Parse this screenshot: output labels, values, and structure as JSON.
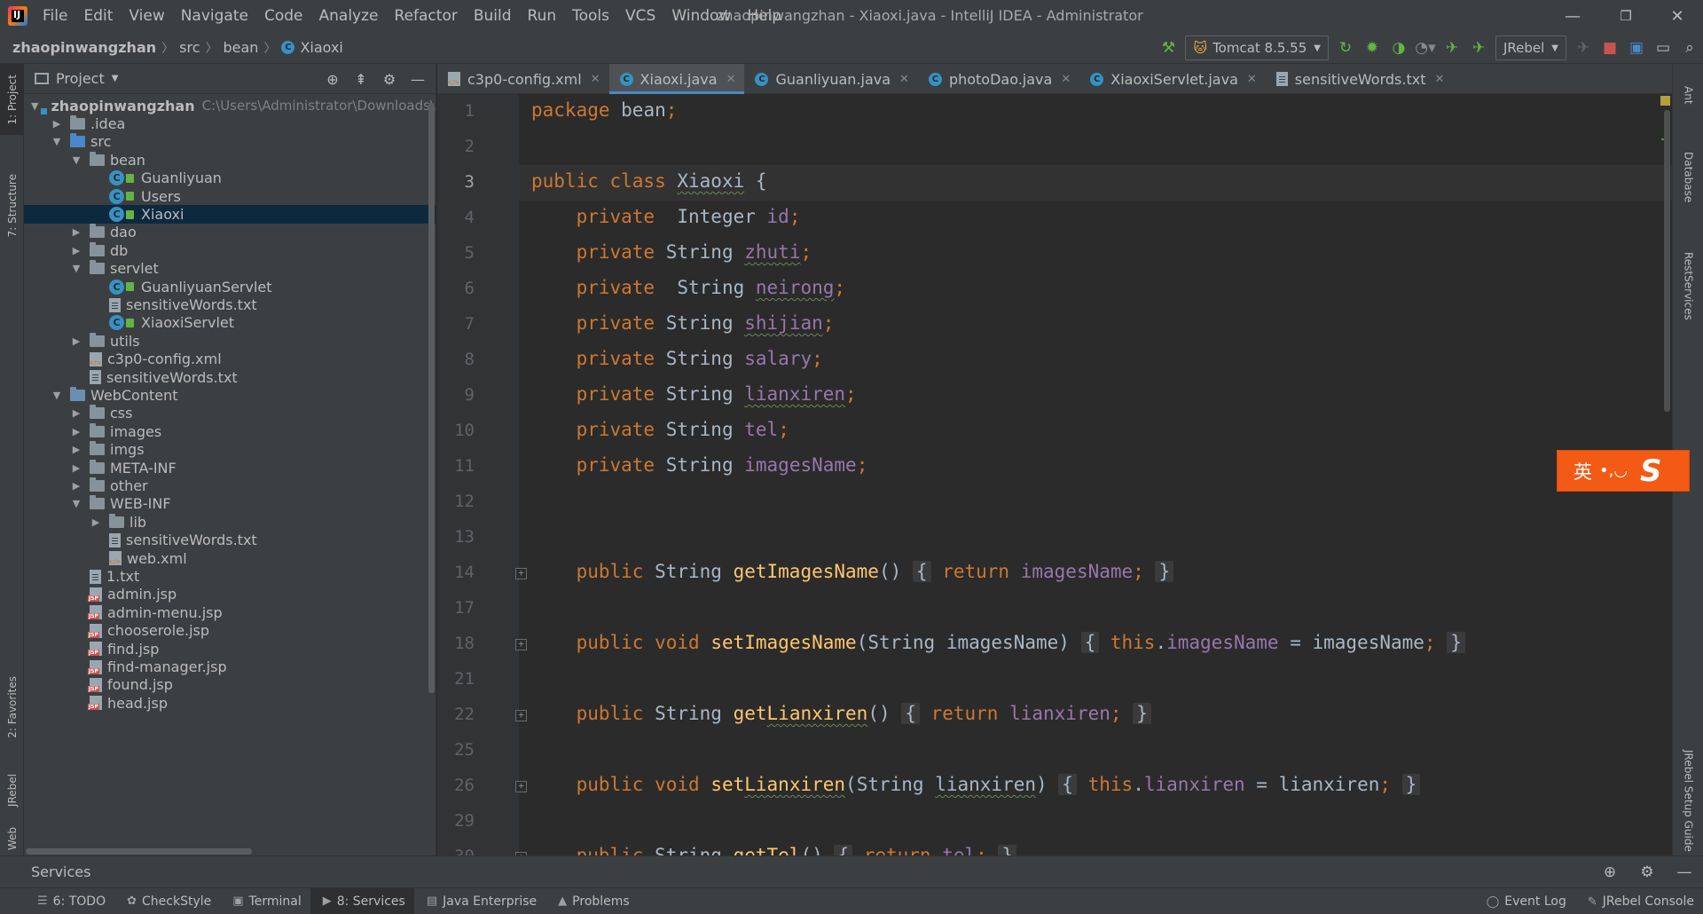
{
  "app": {
    "logo_text": "IJ",
    "window_title": "zhaopinwangzhan - Xiaoxi.java - IntelliJ IDEA - Administrator"
  },
  "menu": [
    "File",
    "Edit",
    "View",
    "Navigate",
    "Code",
    "Analyze",
    "Refactor",
    "Build",
    "Run",
    "Tools",
    "VCS",
    "Window",
    "Help"
  ],
  "window_controls": {
    "minimize": "—",
    "restore": "❐",
    "close": "✕"
  },
  "breadcrumb": {
    "project": "zhaopinwangzhan",
    "src": "src",
    "pkg": "bean",
    "cls": "Xiaoxi"
  },
  "toolbar": {
    "run_config": "Tomcat 8.5.55",
    "jrebel": "JRebel"
  },
  "left_tools": {
    "project": "1: Project",
    "structure": "7: Structure",
    "favorites": "2: Favorites",
    "jrebel": "JRebel",
    "web": "Web"
  },
  "right_tools": {
    "ant": "Ant",
    "database": "Database",
    "rest": "RestServices",
    "jrebel_guide": "JRebel Setup Guide"
  },
  "project_panel": {
    "title": "Project",
    "tree": [
      {
        "label": "zhaopinwangzhan",
        "depth": 0,
        "icon": "module",
        "open": true,
        "bold": true,
        "hint": "C:\\Users\\Administrator\\Downloads\\z"
      },
      {
        "label": ".idea",
        "depth": 1,
        "icon": "folder",
        "open": false
      },
      {
        "label": "src",
        "depth": 1,
        "icon": "folder-src",
        "open": true
      },
      {
        "label": "bean",
        "depth": 2,
        "icon": "folder",
        "open": true
      },
      {
        "label": "Guanliyuan",
        "depth": 3,
        "icon": "class"
      },
      {
        "label": "Users",
        "depth": 3,
        "icon": "class"
      },
      {
        "label": "Xiaoxi",
        "depth": 3,
        "icon": "class",
        "selected": true
      },
      {
        "label": "dao",
        "depth": 2,
        "icon": "folder",
        "open": false
      },
      {
        "label": "db",
        "depth": 2,
        "icon": "folder",
        "open": false
      },
      {
        "label": "servlet",
        "depth": 2,
        "icon": "folder",
        "open": true
      },
      {
        "label": "GuanliyuanServlet",
        "depth": 3,
        "icon": "class"
      },
      {
        "label": "sensitiveWords.txt",
        "depth": 3,
        "icon": "file"
      },
      {
        "label": "XiaoxiServlet",
        "depth": 3,
        "icon": "class"
      },
      {
        "label": "utils",
        "depth": 2,
        "icon": "folder",
        "open": false
      },
      {
        "label": "c3p0-config.xml",
        "depth": 2,
        "icon": "xml"
      },
      {
        "label": "sensitiveWords.txt",
        "depth": 2,
        "icon": "file"
      },
      {
        "label": "WebContent",
        "depth": 1,
        "icon": "folder-web",
        "open": true
      },
      {
        "label": "css",
        "depth": 2,
        "icon": "folder",
        "open": false
      },
      {
        "label": "images",
        "depth": 2,
        "icon": "folder",
        "open": false
      },
      {
        "label": "imgs",
        "depth": 2,
        "icon": "folder",
        "open": false
      },
      {
        "label": "META-INF",
        "depth": 2,
        "icon": "folder",
        "open": false
      },
      {
        "label": "other",
        "depth": 2,
        "icon": "folder",
        "open": false
      },
      {
        "label": "WEB-INF",
        "depth": 2,
        "icon": "folder",
        "open": true
      },
      {
        "label": "lib",
        "depth": 3,
        "icon": "folder",
        "open": false
      },
      {
        "label": "sensitiveWords.txt",
        "depth": 3,
        "icon": "file"
      },
      {
        "label": "web.xml",
        "depth": 3,
        "icon": "xml"
      },
      {
        "label": "1.txt",
        "depth": 2,
        "icon": "file"
      },
      {
        "label": "admin.jsp",
        "depth": 2,
        "icon": "jsp"
      },
      {
        "label": "admin-menu.jsp",
        "depth": 2,
        "icon": "jsp"
      },
      {
        "label": "chooserole.jsp",
        "depth": 2,
        "icon": "jsp"
      },
      {
        "label": "find.jsp",
        "depth": 2,
        "icon": "jsp"
      },
      {
        "label": "find-manager.jsp",
        "depth": 2,
        "icon": "jsp"
      },
      {
        "label": "found.jsp",
        "depth": 2,
        "icon": "jsp"
      },
      {
        "label": "head.jsp",
        "depth": 2,
        "icon": "jsp"
      }
    ]
  },
  "editor_tabs": [
    {
      "label": "c3p0-config.xml",
      "icon": "xml"
    },
    {
      "label": "Xiaoxi.java",
      "icon": "class",
      "active": true
    },
    {
      "label": "Guanliyuan.java",
      "icon": "class"
    },
    {
      "label": "photoDao.java",
      "icon": "class"
    },
    {
      "label": "XiaoxiServlet.java",
      "icon": "class"
    },
    {
      "label": "sensitiveWords.txt",
      "icon": "file"
    }
  ],
  "editor": {
    "current_line": "3",
    "lines": [
      {
        "n": "1",
        "html": "<span class=\"kw\">package</span> bean<span class=\"punc\">;</span>"
      },
      {
        "n": "2",
        "html": ""
      },
      {
        "n": "3",
        "html": "<span class=\"kw\">public class</span> <span class=\"wave\">Xiaoxi</span> {"
      },
      {
        "n": "4",
        "html": "    <span class=\"kw\">private</span>  Integer <span class=\"fld\">id</span><span class=\"punc\">;</span>"
      },
      {
        "n": "5",
        "html": "    <span class=\"kw\">private</span> String <span class=\"fld wave\">zhuti</span><span class=\"punc\">;</span>"
      },
      {
        "n": "6",
        "html": "    <span class=\"kw\">private</span>  String <span class=\"fld wave\">neirong</span><span class=\"punc\">;</span>"
      },
      {
        "n": "7",
        "html": "    <span class=\"kw\">private</span> String <span class=\"fld wave\">shijian</span><span class=\"punc\">;</span>"
      },
      {
        "n": "8",
        "html": "    <span class=\"kw\">private</span> String <span class=\"fld\">salary</span><span class=\"punc\">;</span>"
      },
      {
        "n": "9",
        "html": "    <span class=\"kw\">private</span> String <span class=\"fld wave\">lianxiren</span><span class=\"punc\">;</span>"
      },
      {
        "n": "10",
        "html": "    <span class=\"kw\">private</span> String <span class=\"fld\">tel</span><span class=\"punc\">;</span>"
      },
      {
        "n": "11",
        "html": "    <span class=\"kw\">private</span> String <span class=\"fld\">imagesName</span><span class=\"punc\">;</span>"
      },
      {
        "n": "12",
        "html": ""
      },
      {
        "n": "13",
        "html": ""
      },
      {
        "n": "14",
        "html": "    <span class=\"kw\">public</span> String <span class=\"mth\">getImagesName</span>() <span class=\"fbox\">{</span> <span class=\"kw\">return</span> <span class=\"fld\">imagesName</span><span class=\"punc\">;</span> <span class=\"fbox\">}</span>",
        "fold": true
      },
      {
        "n": "17",
        "html": ""
      },
      {
        "n": "18",
        "html": "    <span class=\"kw\">public void</span> <span class=\"mth\">setImagesName</span>(String imagesName) <span class=\"fbox\">{</span> <span class=\"kw\">this</span>.<span class=\"fld\">imagesName</span> = imagesName<span class=\"punc\">;</span> <span class=\"fbox\">}</span>",
        "fold": true
      },
      {
        "n": "21",
        "html": ""
      },
      {
        "n": "22",
        "html": "    <span class=\"kw\">public</span> String <span class=\"mth\">get<span class=\"wave\">Lianxiren</span></span>() <span class=\"fbox\">{</span> <span class=\"kw\">return</span> <span class=\"fld\">lianxiren</span><span class=\"punc\">;</span> <span class=\"fbox\">}</span>",
        "fold": true
      },
      {
        "n": "25",
        "html": ""
      },
      {
        "n": "26",
        "html": "    <span class=\"kw\">public void</span> <span class=\"mth\">set<span class=\"wave\">Lianxiren</span></span>(String <span class=\"wave\">lianxiren</span>) <span class=\"fbox\">{</span> <span class=\"kw\">this</span>.<span class=\"fld\">lianxiren</span> = lianxiren<span class=\"punc\">;</span> <span class=\"fbox\">}</span>",
        "fold": true
      },
      {
        "n": "29",
        "html": ""
      },
      {
        "n": "30",
        "html": "    <span class=\"kw\">public</span> String <span class=\"mth\">getTel</span>() <span class=\"fbox\">{</span> <span class=\"kw\">return</span> <span class=\"fld\">tel</span><span class=\"punc\">;</span> <span class=\"fbox\">}</span>",
        "fold": true
      }
    ]
  },
  "ime": {
    "lang": "英",
    "punct": "•,◡",
    "logo": "S"
  },
  "services": {
    "title": "Services"
  },
  "bottom_tabs": [
    {
      "label": "6: TODO",
      "icon": "☰"
    },
    {
      "label": "CheckStyle",
      "icon": "✿"
    },
    {
      "label": "Terminal",
      "icon": "▣"
    },
    {
      "label": "8: Services",
      "icon": "▶",
      "active": true
    },
    {
      "label": "Java Enterprise",
      "icon": "▤"
    },
    {
      "label": "Problems",
      "icon": "▲"
    }
  ],
  "bottom_right": [
    {
      "label": "Event Log",
      "icon": "◯"
    },
    {
      "label": "JRebel Console",
      "icon": "✎"
    }
  ]
}
